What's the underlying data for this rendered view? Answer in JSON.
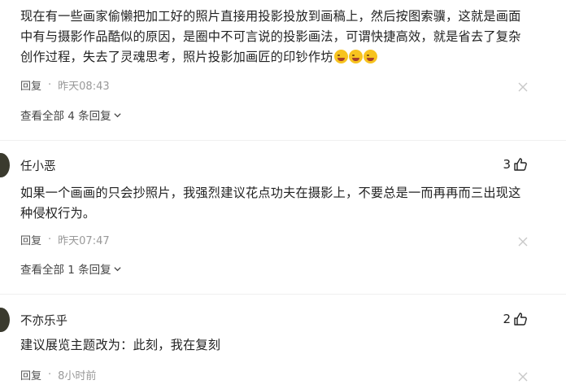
{
  "comments": [
    {
      "text": "现在有一些画家偷懒把加工好的照片直接用投影投放到画稿上，然后按图索骥，这就是画面中有与摄影作品酷似的原因，是圈中不可言说的投影画法，可谓快捷高效，就是省去了复杂创作过程，失去了灵魂思考，照片投影加画匠的印钞作坊",
      "emojis": [
        "laughing-crying-emoji",
        "laughing-crying-emoji",
        "laughing-crying-emoji"
      ],
      "reply_label": "回复",
      "separator": "·",
      "time": "昨天08:43",
      "view_all": "查看全部 4 条回复"
    },
    {
      "author": "任小恶",
      "likes": "3",
      "text": "如果一个画画的只会抄照片，我强烈建议花点功夫在摄影上，不要总是一而再再而三出现这种侵权行为。",
      "reply_label": "回复",
      "separator": "·",
      "time": "昨天07:47",
      "view_all": "查看全部 1 条回复"
    },
    {
      "author": "不亦乐乎",
      "likes": "2",
      "text": "建议展览主题改为：此刻，我在复刻",
      "reply_label": "回复",
      "separator": "·",
      "time": "8小时前"
    }
  ],
  "colors": {
    "text": "#222222",
    "meta": "#999999",
    "divider": "#f0f0f0"
  }
}
